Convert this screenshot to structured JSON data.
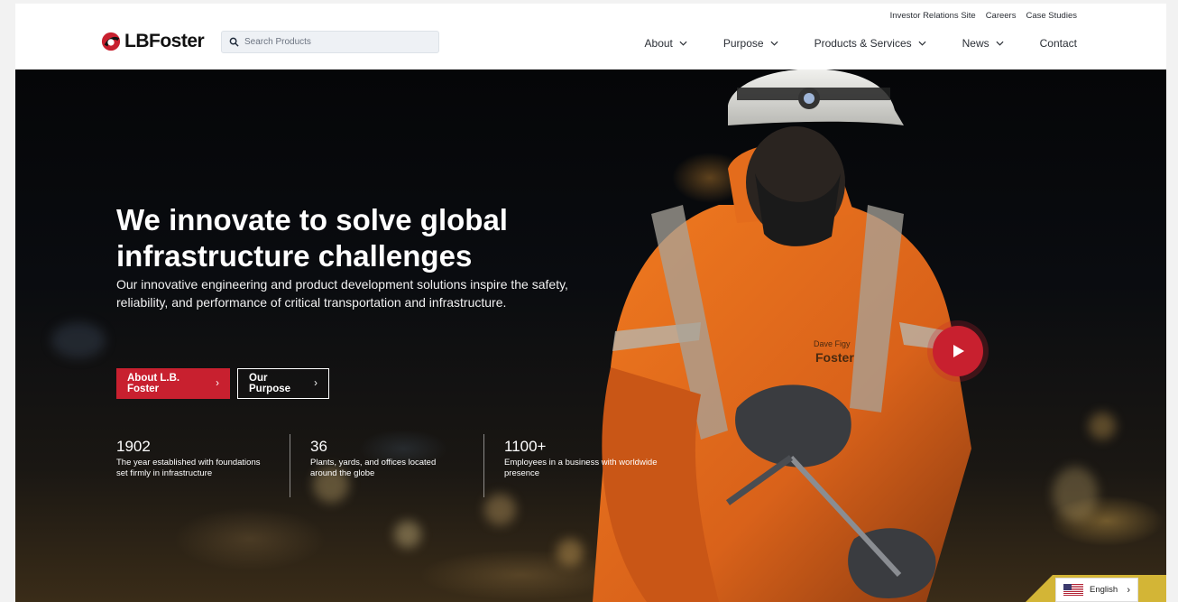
{
  "brand": {
    "name": "LBFoster",
    "name_prefix": "LB",
    "name_suffix": "Foster",
    "colors": {
      "accent": "#c8202f",
      "text": "#2b2f36"
    }
  },
  "search": {
    "placeholder": "Search Products"
  },
  "util_nav": [
    "Investor Relations Site",
    "Careers",
    "Case Studies"
  ],
  "main_nav": [
    {
      "label": "About",
      "dropdown": true
    },
    {
      "label": "Purpose",
      "dropdown": true
    },
    {
      "label": "Products & Services",
      "dropdown": true
    },
    {
      "label": "News",
      "dropdown": true
    },
    {
      "label": "Contact",
      "dropdown": false
    }
  ],
  "hero": {
    "title_line1": "We innovate to solve global",
    "title_line2": "infrastructure challenges",
    "subtitle": "Our innovative engineering and product development solutions inspire the safety, reliability, and performance of critical transportation and infrastructure.",
    "buttons": {
      "primary": "About L.B. Foster",
      "secondary": "Our Purpose"
    },
    "stats": [
      {
        "value": "1902",
        "description": "The year established with foundations set firmly in infrastructure"
      },
      {
        "value": "36",
        "description": "Plants, yards, and offices located around the globe"
      },
      {
        "value": "1100+",
        "description": "Employees in a business with worldwide presence"
      }
    ],
    "jacket_text": {
      "line1": "Dave Figy",
      "line2": "Foster"
    }
  },
  "language": {
    "label": "English"
  }
}
